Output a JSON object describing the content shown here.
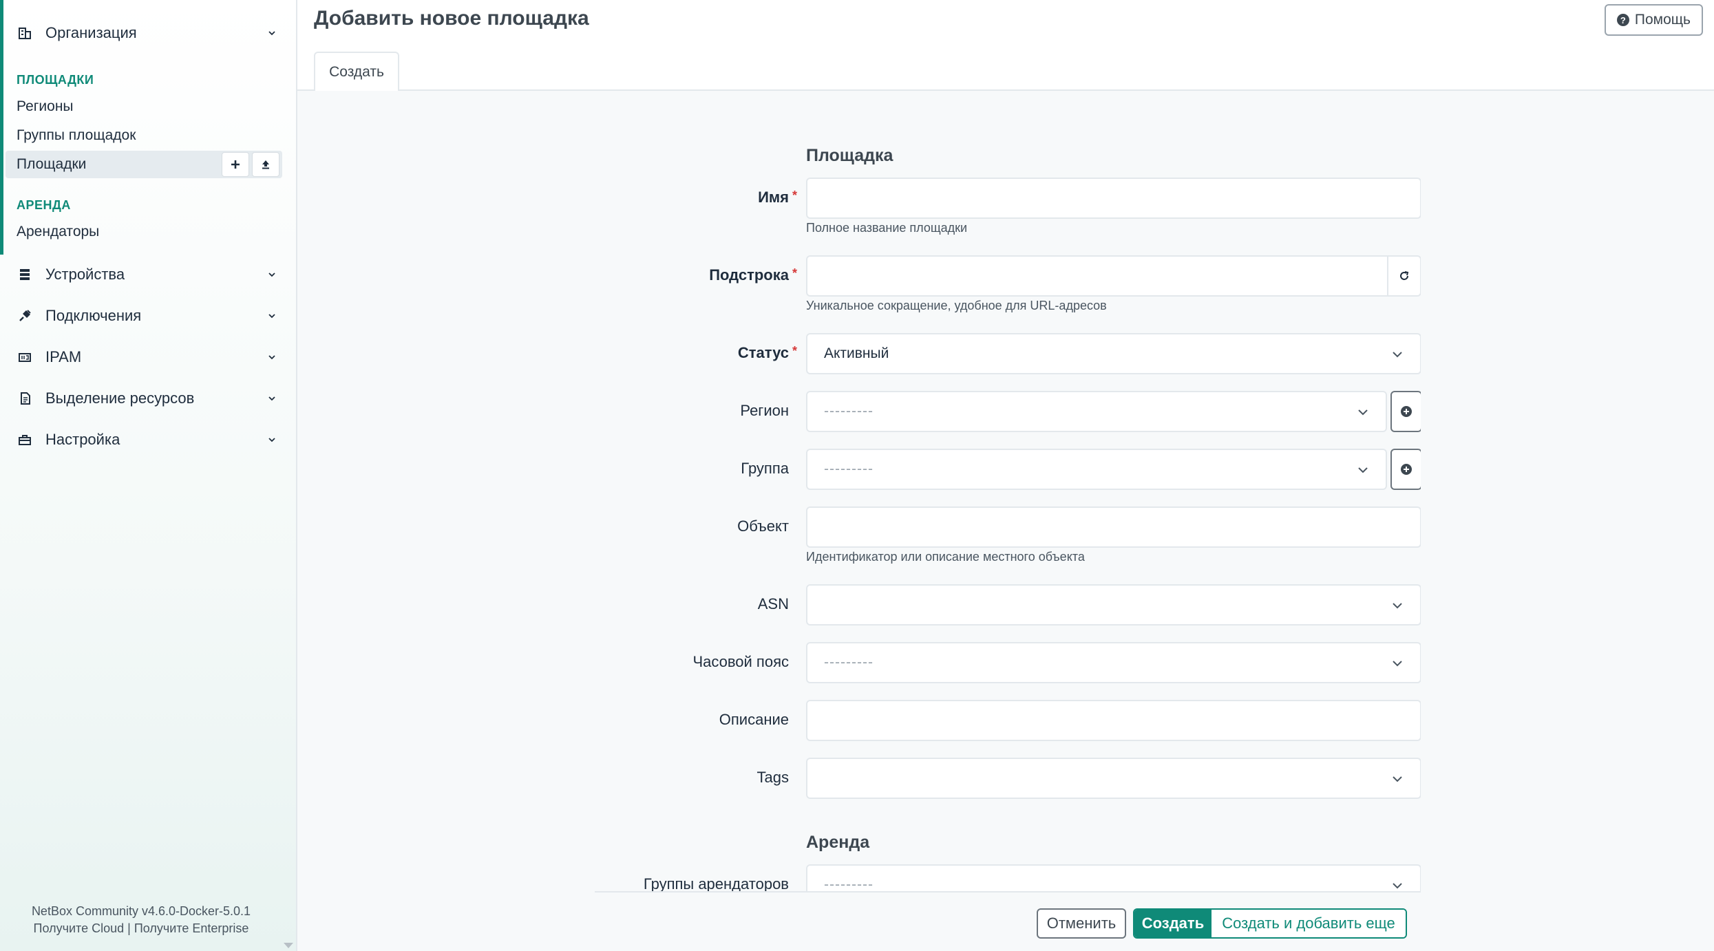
{
  "sidebar": {
    "org_group": "Организация",
    "sections": [
      {
        "header": "ПЛОЩАДКИ",
        "items": [
          "Регионы",
          "Группы площадок"
        ],
        "active_item": "Площадки"
      },
      {
        "header": "АРЕНДА",
        "items": [
          "Арендаторы"
        ]
      }
    ],
    "groups": [
      "Устройства",
      "Подключения",
      "IPAM",
      "Выделение ресурсов",
      "Настройка"
    ],
    "footer": {
      "version": "NetBox Community v4.6.0-Docker-5.0.1",
      "link_cloud": "Получите Cloud",
      "separator": "|",
      "link_enterprise": "Получите Enterprise"
    }
  },
  "header": {
    "title": "Добавить новое площадка",
    "help_label": "Помощь",
    "tab": "Создать"
  },
  "form": {
    "section_site": "Площадка",
    "section_tenancy": "Аренда",
    "name": {
      "label": "Имя",
      "value": "",
      "hint": "Полное название площадки"
    },
    "slug": {
      "label": "Подстрока",
      "value": "",
      "hint": "Уникальное сокращение, удобное для URL-адресов"
    },
    "status": {
      "label": "Статус",
      "value": "Активный"
    },
    "region": {
      "label": "Регион",
      "value": "---------"
    },
    "group": {
      "label": "Группа",
      "value": "---------"
    },
    "facility": {
      "label": "Объект",
      "value": "",
      "hint": "Идентификатор или описание местного объекта"
    },
    "asn": {
      "label": "ASN",
      "value": ""
    },
    "timezone": {
      "label": "Часовой пояс",
      "value": "---------"
    },
    "description": {
      "label": "Описание",
      "value": ""
    },
    "tags": {
      "label": "Tags",
      "value": ""
    },
    "tenant_group": {
      "label": "Группы арендаторов",
      "value": "---------"
    }
  },
  "actions": {
    "cancel": "Отменить",
    "create": "Создать",
    "create_and_add": "Создать и добавить еще"
  },
  "colors": {
    "accent": "#0f8a78",
    "required": "#d63939"
  }
}
